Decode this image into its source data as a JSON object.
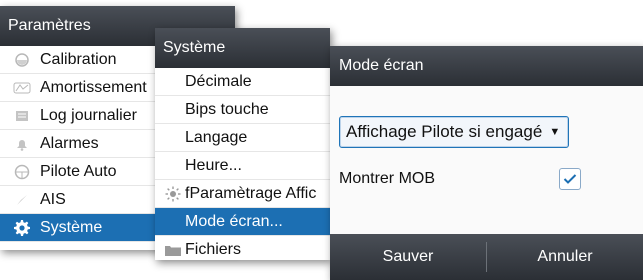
{
  "panel1": {
    "title": "Paramètres",
    "items": [
      {
        "label": "Calibration",
        "icon": "calibration-icon"
      },
      {
        "label": "Amortissement",
        "icon": "damping-icon"
      },
      {
        "label": "Log journalier",
        "icon": "log-icon"
      },
      {
        "label": "Alarmes",
        "icon": "bell-icon"
      },
      {
        "label": "Pilote Auto",
        "icon": "steering-wheel-icon"
      },
      {
        "label": "AIS",
        "icon": "ais-icon"
      },
      {
        "label": "Système",
        "icon": "gear-icon",
        "selected": true
      }
    ]
  },
  "panel2": {
    "title": "Système",
    "items": [
      {
        "label": "Décimale"
      },
      {
        "label": "Bips touche"
      },
      {
        "label": "Langage"
      },
      {
        "label": "Heure..."
      },
      {
        "label": "fParamètrage Affic",
        "icon": "brightness-icon"
      },
      {
        "label": "Mode écran...",
        "selected": true
      },
      {
        "label": "Fichiers",
        "icon": "folder-icon"
      }
    ]
  },
  "dialog": {
    "title": "Mode écran",
    "dropdown_value": "Affichage Pilote si engagé",
    "mob_label": "Montrer MOB",
    "mob_checked": true,
    "save_label": "Sauver",
    "cancel_label": "Annuler"
  },
  "colors": {
    "selection": "#1c6fb3",
    "titlebar": "#3a3f46",
    "accent_border": "#1f74b8"
  }
}
